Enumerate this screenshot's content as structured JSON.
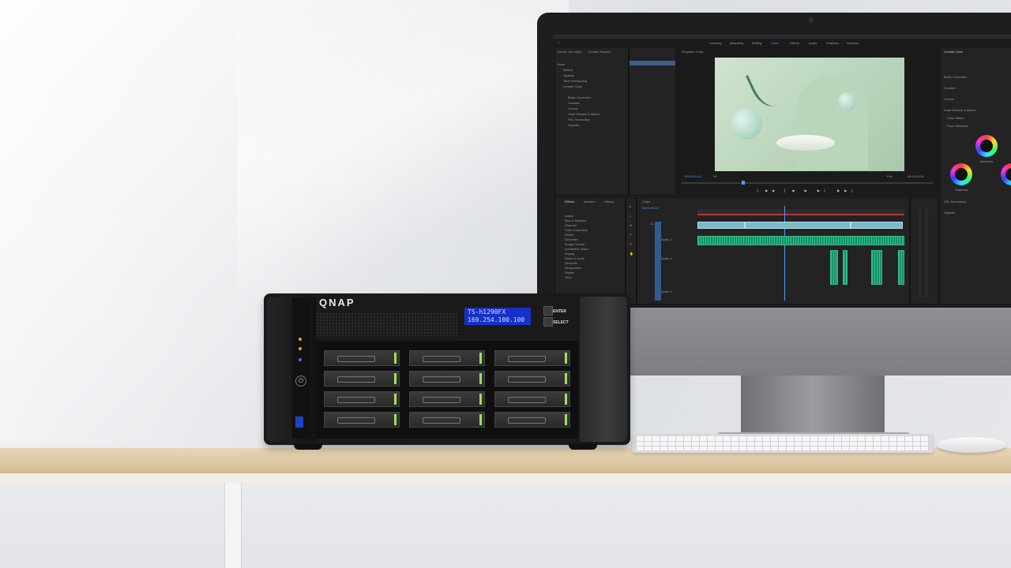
{
  "nas": {
    "brand": "QNAP",
    "lcd_line1": "TS-h1290FX",
    "lcd_line2": "169.254.100.100",
    "btn_enter": "ENTER",
    "btn_select": "SELECT"
  },
  "premiere": {
    "workspaces": [
      "Learning",
      "Assembly",
      "Editing",
      "Color",
      "Effects",
      "Audio",
      "Graphics",
      "Libraries"
    ],
    "panels": {
      "source_tabs": [
        "Source: (no clips)",
        "Lumetri Scopes",
        "Effect Controls",
        "Audio Clip Mixer: Cl"
      ],
      "program_title": "Program: Chips",
      "lumetri_title": "Lumetri Color",
      "effects_tabs": [
        "Effects",
        "Markers",
        "History"
      ],
      "timeline_title": "Chips"
    },
    "effect_controls": [
      "Video",
      "Motion",
      "Opacity",
      "Time Remapping",
      "Lumetri Color",
      "Basic Correction",
      "Creative",
      "Curves",
      "Color Wheels & Match",
      "HSL Secondary",
      "Vignette"
    ],
    "effects_list": [
      "Adjust",
      "Blur & Sharpen",
      "Channel",
      "Color Correction",
      "Distort",
      "Generate",
      "Image Control",
      "Immersive Video",
      "Keying",
      "Noise & Grain",
      "Obsolete",
      "Perspective",
      "Stylize",
      "Time"
    ],
    "lumetri_sections": [
      "Basic Correction",
      "Creative",
      "Curves",
      "Color Wheels & Match",
      "Color Match",
      "Face Detection",
      "HSL Secondary",
      "Vignette"
    ],
    "wheel_labels": [
      "Midtones",
      "Shadows",
      "Highlights"
    ],
    "timecode_program": "00:01:51:12",
    "timecode_duration": "00:03:42:02",
    "timecode_timeline": "00:01:51:12",
    "fit_label": "Fit",
    "full_label": "Full",
    "tracks": [
      "V1",
      "A1",
      "A2",
      "A3"
    ],
    "track_labels": [
      "Audio 1",
      "Audio 2",
      "Audio 3"
    ]
  }
}
